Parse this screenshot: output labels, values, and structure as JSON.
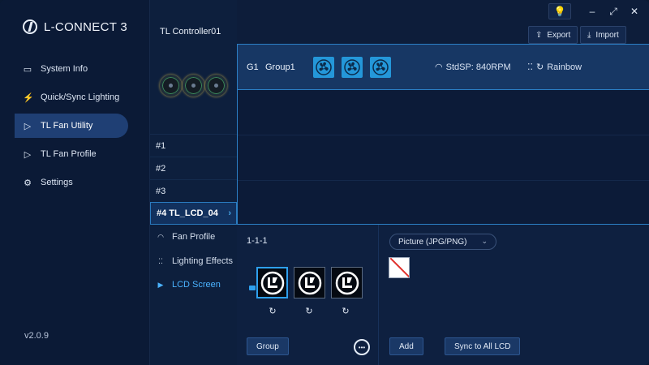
{
  "app": {
    "logo_text": "L-CONNECT 3",
    "version": "v2.0.9"
  },
  "sidebar": {
    "items": [
      {
        "label": "System Info",
        "icon": "monitor-icon"
      },
      {
        "label": "Quick/Sync Lighting",
        "icon": "lightning-icon"
      },
      {
        "label": "TL Fan Utility",
        "icon": "fan-utility-icon",
        "active": true
      },
      {
        "label": "TL Fan Profile",
        "icon": "fan-profile-icon"
      },
      {
        "label": "Settings",
        "icon": "gear-icon"
      }
    ]
  },
  "controller": {
    "title": "TL Controller01"
  },
  "slots": [
    {
      "label": "#1"
    },
    {
      "label": "#2"
    },
    {
      "label": "#3"
    },
    {
      "label": "#4 TL_LCD_04",
      "selected": true
    }
  ],
  "submenu": [
    {
      "label": "Fan Profile",
      "icon": "speed-icon"
    },
    {
      "label": "Lighting Effects",
      "icon": "dots-icon"
    },
    {
      "label": "LCD Screen",
      "icon": "lcd-icon",
      "active": true
    }
  ],
  "toolbar": {
    "export_label": "Export",
    "import_label": "Import"
  },
  "group": {
    "id": "G1",
    "name": "Group1",
    "fan_count": 3,
    "speed": "StdSP: 840RPM",
    "lighting": "Rainbow"
  },
  "lcd": {
    "code": "1-1-1",
    "group_button": "Group",
    "dropdown_value": "Picture (JPG/PNG)",
    "add_button": "Add",
    "sync_button": "Sync to All LCD"
  },
  "colors": {
    "accent": "#2ea0ee",
    "fan_tile": "#2497d9",
    "active_nav": "#1f3f74"
  }
}
